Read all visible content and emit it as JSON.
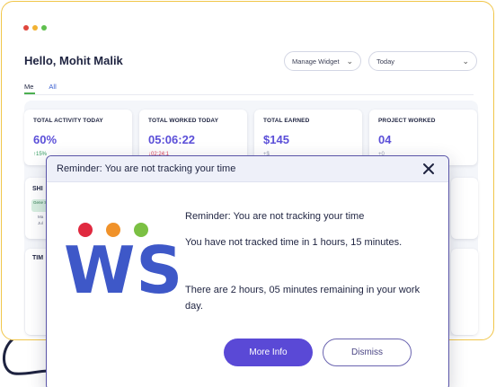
{
  "window": {
    "dots": [
      "#e0463c",
      "#f2b233",
      "#5fbf4e"
    ]
  },
  "dashboard": {
    "greeting": "Hello, Mohit Malik",
    "dropdowns": {
      "widget_label": "Manage Widget",
      "period_value": "Today"
    },
    "tabs": [
      {
        "label": "Me",
        "active": true
      },
      {
        "label": "All",
        "active": false
      }
    ],
    "cards": [
      {
        "label": "TOTAL ACTIVITY TODAY",
        "value": "60%",
        "delta": "↑15%"
      },
      {
        "label": "TOTAL WORKED TODAY",
        "value": "05:06:22",
        "delta": "↓02:24:1"
      },
      {
        "label": "TOTAL EARNED",
        "value": "$145",
        "delta": "+$"
      },
      {
        "label": "PROJECT WORKED",
        "value": "04",
        "delta": "+0"
      }
    ],
    "shift_panel": {
      "title": "SHI",
      "chip": "Gene Shi",
      "line1": "Ma",
      "line2": "Jul"
    },
    "time_panel": {
      "title": "TIM"
    }
  },
  "modal": {
    "title": "Reminder: You are not tracking your time",
    "logo_text": "WS",
    "logo_dot_colors": [
      "#e0293f",
      "#f0922a",
      "#7bc043"
    ],
    "message_title": "Reminder: You are not tracking your time",
    "message_body": "You have not tracked time in 1 hours, 15 minutes.",
    "message_remaining": "There are 2 hours, 05 minutes remaining in your work day.",
    "more_info_label": "More Info",
    "dismiss_label": "Dismiss",
    "accent_color": "#5a49d6"
  }
}
